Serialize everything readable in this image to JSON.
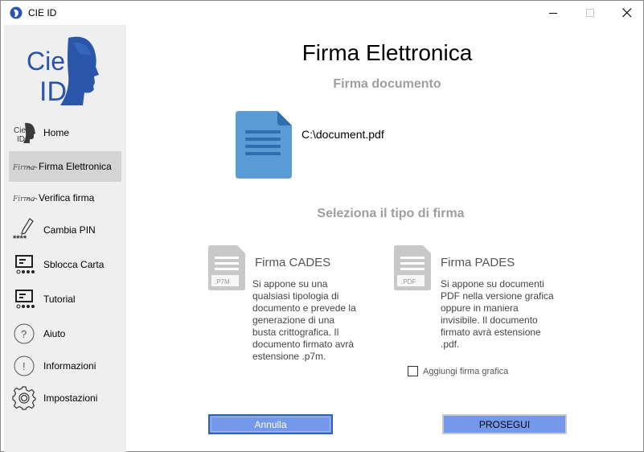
{
  "window": {
    "title": "CIE ID"
  },
  "sidebar": {
    "logo_text": [
      "Cie",
      "ID"
    ],
    "items": [
      {
        "label": "Home",
        "icon": "cie-id-icon"
      },
      {
        "label": "Firma Elettronica",
        "icon": "signature-icon",
        "active": true
      },
      {
        "label": "Verifica firma",
        "icon": "signature-icon"
      },
      {
        "label": "Cambia PIN",
        "icon": "pen-pin-icon"
      },
      {
        "label": "Sblocca Carta",
        "icon": "card-reader-icon"
      },
      {
        "label": "Tutorial",
        "icon": "card-reader-icon"
      },
      {
        "label": "Aiuto",
        "icon": "question-icon"
      },
      {
        "label": "Informazioni",
        "icon": "info-icon"
      },
      {
        "label": "Impostazioni",
        "icon": "gear-icon"
      }
    ],
    "pin_mask": "****",
    "firma_script": "Firma"
  },
  "main": {
    "title": "Firma Elettronica",
    "subtitle": "Firma documento",
    "document_path": "C:\\document.pdf",
    "select_label": "Seleziona il tipo di firma",
    "options": {
      "cades": {
        "title": "Firma CADES",
        "ext": ".P7M",
        "description": [
          "Si appone su una",
          "qualsiasi tipologia di",
          "documento e prevede la",
          "generazione di una",
          "busta crittografica. Il",
          "documento firmato avrà",
          "estensione .p7m."
        ]
      },
      "pades": {
        "title": "Firma PADES",
        "ext": ".PDF",
        "description": [
          "Si appone su documenti",
          "PDF nella versione grafica",
          "oppure in maniera",
          "invisibile. Il documento",
          "firmato avrà estensione",
          ".pdf."
        ]
      }
    },
    "checkbox_label": "Aggiungi firma grafica",
    "checkbox_checked": false,
    "cancel_label": "Annulla",
    "next_label": "PROSEGUI"
  },
  "colors": {
    "accent": "#7599ea",
    "doc_blue": "#5b9bd5",
    "sidebar_bg": "#efefef",
    "active_bg": "#d4d4d4",
    "logo_blue": "#2a55a8"
  }
}
